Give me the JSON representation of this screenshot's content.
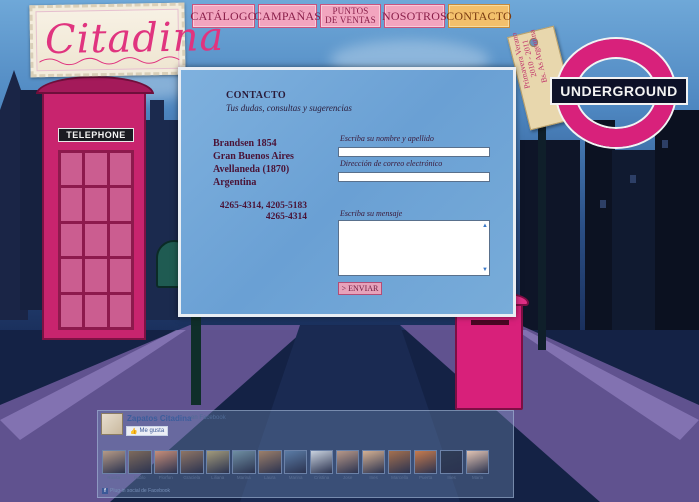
{
  "brand": {
    "logo_text": "Citadina"
  },
  "nav": {
    "items": [
      {
        "label": "CATÁLOGO",
        "lines": []
      },
      {
        "label": "CAMPAÑAS",
        "lines": []
      },
      {
        "label": "",
        "lines": [
          "PUNTOS",
          "DE VENTAS"
        ]
      },
      {
        "label": "NOSOTROS",
        "lines": []
      },
      {
        "label": "CONTACTO",
        "lines": []
      }
    ],
    "active_index": 4,
    "puntos_line1": "PUNTOS",
    "puntos_line2": "DE VENTAS"
  },
  "tag": {
    "line1": "Primavera Verano",
    "line2": "2010 - 2011",
    "line3": "Bs. As Argentina"
  },
  "sign": {
    "underground": "UNDERGROUND",
    "booth": "TELEPHONE"
  },
  "contact": {
    "title": "CONTACTO",
    "subtitle": "Tus dudas, consultas y sugerencias",
    "address": [
      "Brandsen 1854",
      "Gran Buenos Aires",
      "Avellaneda (1870)",
      "Argentina"
    ],
    "phone_line1": "4265-4314, 4205-5183",
    "phone_line2": "4265-4314",
    "form": {
      "name_label": "Escriba su nombre y apellido",
      "email_label": "Dirección de correo electrónico",
      "message_label": "Escriba su mensaje",
      "name_value": "",
      "email_value": "",
      "message_value": "",
      "send_label": "> ENVIAR"
    }
  },
  "facebook": {
    "page_name": "Zapatos Citadina",
    "on_text": "en Facebook",
    "like_label": "Me gusta",
    "plugin_text": "Plug-in social de Facebook",
    "friends": [
      {
        "name": "Rosita",
        "color": "#b59a86"
      },
      {
        "name": "Pablo",
        "color": "#7e6a5c"
      },
      {
        "name": "Florfon",
        "color": "#c78e79"
      },
      {
        "name": "Graciela",
        "color": "#8f7565"
      },
      {
        "name": "Liliana",
        "color": "#a29a7b"
      },
      {
        "name": "Marina",
        "color": "#6f8fa3"
      },
      {
        "name": "Laura",
        "color": "#9c7f6a"
      },
      {
        "name": "Marina",
        "color": "#5b7ca6"
      },
      {
        "name": "Cristina",
        "color": "#c9d2de"
      },
      {
        "name": "Jose",
        "color": "#b79888"
      },
      {
        "name": "Ines",
        "color": "#d4b092"
      },
      {
        "name": "Marcella",
        "color": "#a4704f"
      },
      {
        "name": "Puerta",
        "color": "#c67b4e"
      },
      {
        "name": "Ines",
        "color": "#2f3d56"
      },
      {
        "name": "Maria",
        "color": "#e2c4b4"
      }
    ]
  },
  "colors": {
    "accent": "#e0347f",
    "nav_bg": "#f2a5bf",
    "nav_active": "#f3c06b",
    "panel": "#7fb1de"
  }
}
